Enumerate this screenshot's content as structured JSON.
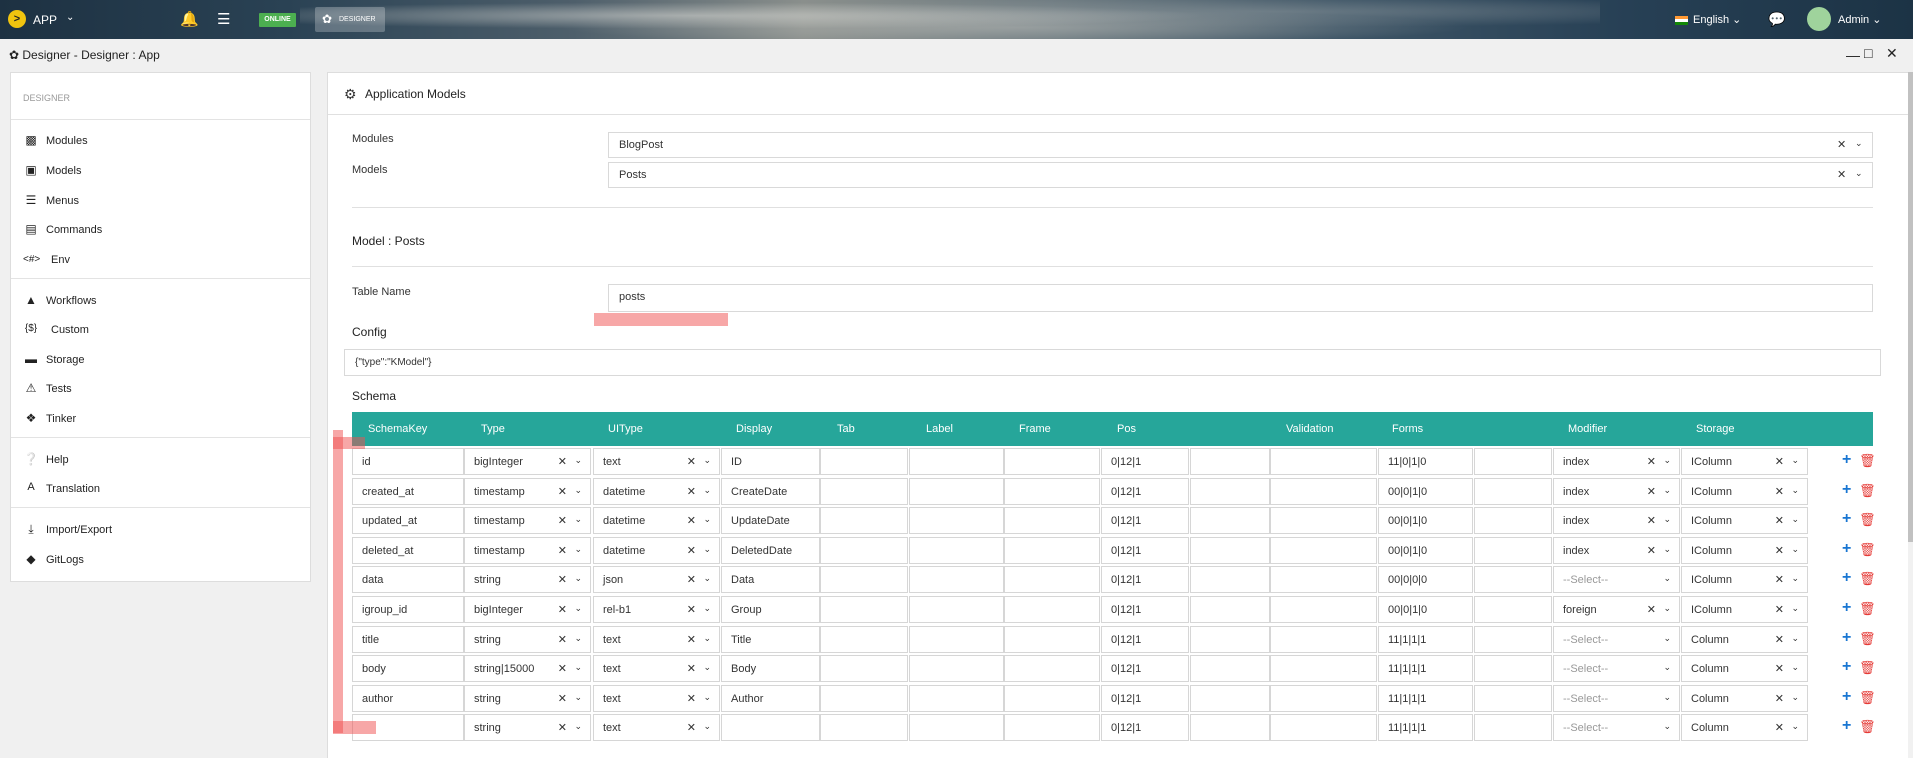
{
  "topbar": {
    "app_label": "APP",
    "status_badge": "ONLINE",
    "designer_button": "DESIGNER",
    "language": "English",
    "user": "Admin"
  },
  "window": {
    "title": "Designer - Designer : App"
  },
  "sidebar": {
    "header": "DESIGNER",
    "items": [
      {
        "label": "Modules",
        "icon": "puzzle-icon"
      },
      {
        "label": "Models",
        "icon": "database-icon"
      },
      {
        "label": "Menus",
        "icon": "menu-icon"
      },
      {
        "label": "Commands",
        "icon": "terminal-icon"
      },
      {
        "label": "Env",
        "icon": "code-icon"
      },
      {
        "label": "Workflows",
        "icon": "sitemap-icon"
      },
      {
        "label": "Custom",
        "icon": "braces-icon"
      },
      {
        "label": "Storage",
        "icon": "folder-icon"
      },
      {
        "label": "Tests",
        "icon": "warning-icon"
      },
      {
        "label": "Tinker",
        "icon": "compass-icon"
      },
      {
        "label": "Help",
        "icon": "help-icon"
      },
      {
        "label": "Translation",
        "icon": "translate-icon"
      },
      {
        "label": "Import/Export",
        "icon": "download-icon"
      },
      {
        "label": "GitLogs",
        "icon": "git-icon"
      }
    ]
  },
  "main": {
    "header": "Application Models",
    "modules_label": "Modules",
    "modules_value": "BlogPost",
    "models_label": "Models",
    "models_value": "Posts",
    "model_title": "Model : Posts",
    "table_name_label": "Table Name",
    "table_name_value": "posts",
    "config_label": "Config",
    "config_value": "{\"type\":\"KModel\"}",
    "schema_label": "Schema"
  },
  "schema": {
    "columns": [
      "SchemaKey",
      "Type",
      "UIType",
      "Display",
      "Tab",
      "Label",
      "Frame",
      "Pos",
      "Validation",
      "Forms",
      "Modifier",
      "Storage"
    ],
    "rows": [
      {
        "key": "id",
        "type": "bigInteger",
        "uitype": "text",
        "display": "ID",
        "tab": "",
        "label": "",
        "frame": "",
        "pos": "0|12|1",
        "pos2": "",
        "validation": "",
        "forms": "11|0|1|0",
        "forms2": "",
        "modifier": "index",
        "storage": "IColumn"
      },
      {
        "key": "created_at",
        "type": "timestamp",
        "uitype": "datetime",
        "display": "CreateDate",
        "tab": "",
        "label": "",
        "frame": "",
        "pos": "0|12|1",
        "pos2": "",
        "validation": "",
        "forms": "00|0|1|0",
        "forms2": "",
        "modifier": "index",
        "storage": "IColumn"
      },
      {
        "key": "updated_at",
        "type": "timestamp",
        "uitype": "datetime",
        "display": "UpdateDate",
        "tab": "",
        "label": "",
        "frame": "",
        "pos": "0|12|1",
        "pos2": "",
        "validation": "",
        "forms": "00|0|1|0",
        "forms2": "",
        "modifier": "index",
        "storage": "IColumn"
      },
      {
        "key": "deleted_at",
        "type": "timestamp",
        "uitype": "datetime",
        "display": "DeletedDate",
        "tab": "",
        "label": "",
        "frame": "",
        "pos": "0|12|1",
        "pos2": "",
        "validation": "",
        "forms": "00|0|1|0",
        "forms2": "",
        "modifier": "index",
        "storage": "IColumn"
      },
      {
        "key": "data",
        "type": "string",
        "uitype": "json",
        "display": "Data",
        "tab": "",
        "label": "",
        "frame": "",
        "pos": "0|12|1",
        "pos2": "",
        "validation": "",
        "forms": "00|0|0|0",
        "forms2": "",
        "modifier": "--Select--",
        "storage": "IColumn"
      },
      {
        "key": "igroup_id",
        "type": "bigInteger",
        "uitype": "rel-b1",
        "display": "Group",
        "tab": "",
        "label": "",
        "frame": "",
        "pos": "0|12|1",
        "pos2": "",
        "validation": "",
        "forms": "00|0|1|0",
        "forms2": "",
        "modifier": "foreign",
        "storage": "IColumn"
      },
      {
        "key": "title",
        "type": "string",
        "uitype": "text",
        "display": "Title",
        "tab": "",
        "label": "",
        "frame": "",
        "pos": "0|12|1",
        "pos2": "",
        "validation": "",
        "forms": "11|1|1|1",
        "forms2": "",
        "modifier": "--Select--",
        "storage": "Column"
      },
      {
        "key": "body",
        "type": "string|15000",
        "uitype": "text",
        "display": "Body",
        "tab": "",
        "label": "",
        "frame": "",
        "pos": "0|12|1",
        "pos2": "",
        "validation": "",
        "forms": "11|1|1|1",
        "forms2": "",
        "modifier": "--Select--",
        "storage": "Column"
      },
      {
        "key": "author",
        "type": "string",
        "uitype": "text",
        "display": "Author",
        "tab": "",
        "label": "",
        "frame": "",
        "pos": "0|12|1",
        "pos2": "",
        "validation": "",
        "forms": "11|1|1|1",
        "forms2": "",
        "modifier": "--Select--",
        "storage": "Column"
      },
      {
        "key": "",
        "type": "string",
        "uitype": "text",
        "display": "",
        "tab": "",
        "label": "",
        "frame": "",
        "pos": "0|12|1",
        "pos2": "",
        "validation": "",
        "forms": "11|1|1|1",
        "forms2": "",
        "modifier": "--Select--",
        "storage": "Column"
      }
    ]
  },
  "colors": {
    "table_header": "#26a69a",
    "add_button": "#1976d2",
    "delete_button": "#e53935",
    "online_badge": "#4caf50"
  }
}
